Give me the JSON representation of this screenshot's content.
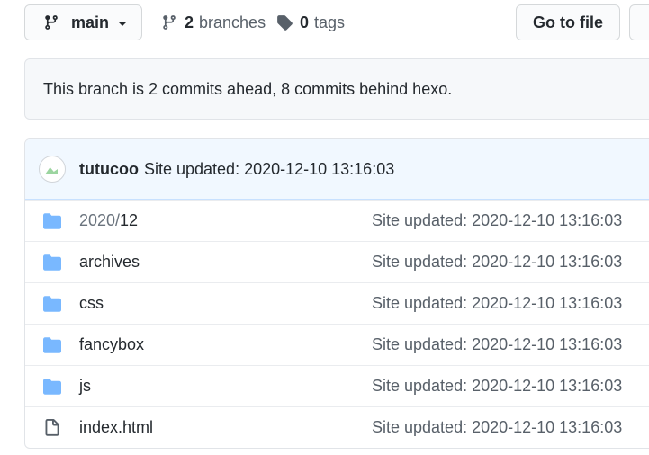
{
  "toolbar": {
    "branch_name": "main",
    "branches_count": "2",
    "branches_label": "branches",
    "tags_count": "0",
    "tags_label": "tags",
    "goto_label": "Go to file"
  },
  "status": {
    "text": "This branch is 2 commits ahead, 8 commits behind hexo."
  },
  "commit": {
    "author": "tutucoo",
    "message": "Site updated: 2020-12-10 13:16:03"
  },
  "files": [
    {
      "name_prefix": "2020/",
      "name": "12",
      "type": "folder",
      "message": "Site updated: 2020-12-10 13:16:03"
    },
    {
      "name_prefix": "",
      "name": "archives",
      "type": "folder",
      "message": "Site updated: 2020-12-10 13:16:03"
    },
    {
      "name_prefix": "",
      "name": "css",
      "type": "folder",
      "message": "Site updated: 2020-12-10 13:16:03"
    },
    {
      "name_prefix": "",
      "name": "fancybox",
      "type": "folder",
      "message": "Site updated: 2020-12-10 13:16:03"
    },
    {
      "name_prefix": "",
      "name": "js",
      "type": "folder",
      "message": "Site updated: 2020-12-10 13:16:03"
    },
    {
      "name_prefix": "",
      "name": "index.html",
      "type": "file",
      "message": "Site updated: 2020-12-10 13:16:03"
    }
  ],
  "colors": {
    "folder": "#79b8ff",
    "file_icon": "#586069"
  },
  "icons": {
    "branch": "git-branch-icon",
    "tag": "tag-icon",
    "folder": "folder-icon",
    "file": "file-icon"
  }
}
